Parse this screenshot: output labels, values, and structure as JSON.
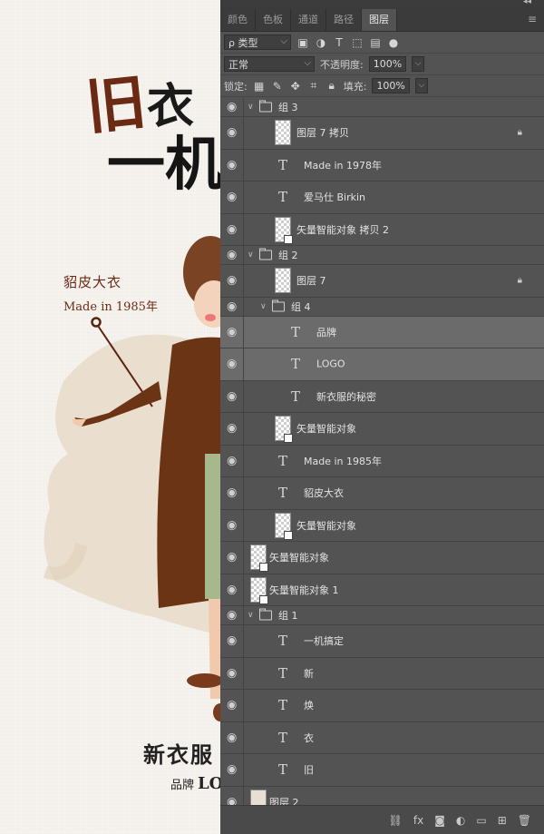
{
  "canvas": {
    "title_chars": [
      "旧",
      "衣",
      "一机"
    ],
    "fur_label": "貂皮大衣",
    "fur_made": "Made in 1985年",
    "bottom_title": "新衣服",
    "bottom_brand": "品牌",
    "bottom_logo": "LO"
  },
  "panel": {
    "tabs": [
      "颜色",
      "色板",
      "通道",
      "路径",
      "图层"
    ],
    "active_tab": "图层",
    "filter_label": "ρ 类型",
    "blend_mode": "正常",
    "opacity_label": "不透明度:",
    "opacity_value": "100%",
    "lock_label": "锁定:",
    "fill_label": "填充:",
    "fill_value": "100%",
    "layers": [
      {
        "kind": "group",
        "name": "组 3",
        "indent": 0
      },
      {
        "kind": "pixel",
        "name": "图层 7 拷贝",
        "indent": 1,
        "locked": true
      },
      {
        "kind": "text",
        "name": "Made in 1978年",
        "indent": 1
      },
      {
        "kind": "text",
        "name": "爱马仕 Birkin",
        "indent": 1
      },
      {
        "kind": "smart",
        "name": "矢量智能对象 拷贝 2",
        "indent": 1
      },
      {
        "kind": "group",
        "name": "组 2",
        "indent": 0
      },
      {
        "kind": "pixel",
        "name": "图层 7",
        "indent": 1,
        "locked": true
      },
      {
        "kind": "group",
        "name": "组 4",
        "indent": 1
      },
      {
        "kind": "text",
        "name": "品牌",
        "indent": 2,
        "selected": true
      },
      {
        "kind": "text",
        "name": "LOGO",
        "indent": 2,
        "selected": true
      },
      {
        "kind": "text",
        "name": "新衣服的秘密",
        "indent": 2
      },
      {
        "kind": "smart",
        "name": "矢量智能对象",
        "indent": 1
      },
      {
        "kind": "text",
        "name": "Made in 1985年",
        "indent": 1
      },
      {
        "kind": "text",
        "name": "貂皮大衣",
        "indent": 1
      },
      {
        "kind": "smart",
        "name": "矢量智能对象",
        "indent": 1
      },
      {
        "kind": "smart",
        "name": "矢量智能对象",
        "indent": 0
      },
      {
        "kind": "smart",
        "name": "矢量智能对象 1",
        "indent": 0
      },
      {
        "kind": "group",
        "name": "组 1",
        "indent": 0
      },
      {
        "kind": "text",
        "name": "一机搞定",
        "indent": 1
      },
      {
        "kind": "text",
        "name": "新",
        "indent": 1
      },
      {
        "kind": "text",
        "name": "焕",
        "indent": 1
      },
      {
        "kind": "text",
        "name": "衣",
        "indent": 1
      },
      {
        "kind": "text",
        "name": "旧",
        "indent": 1
      },
      {
        "kind": "image",
        "name": "图层 2",
        "indent": 0
      }
    ]
  },
  "colors": {
    "panel_bg": "#535353",
    "selected_row": "#6b6b6b",
    "accent_brown": "#6b2a14"
  }
}
